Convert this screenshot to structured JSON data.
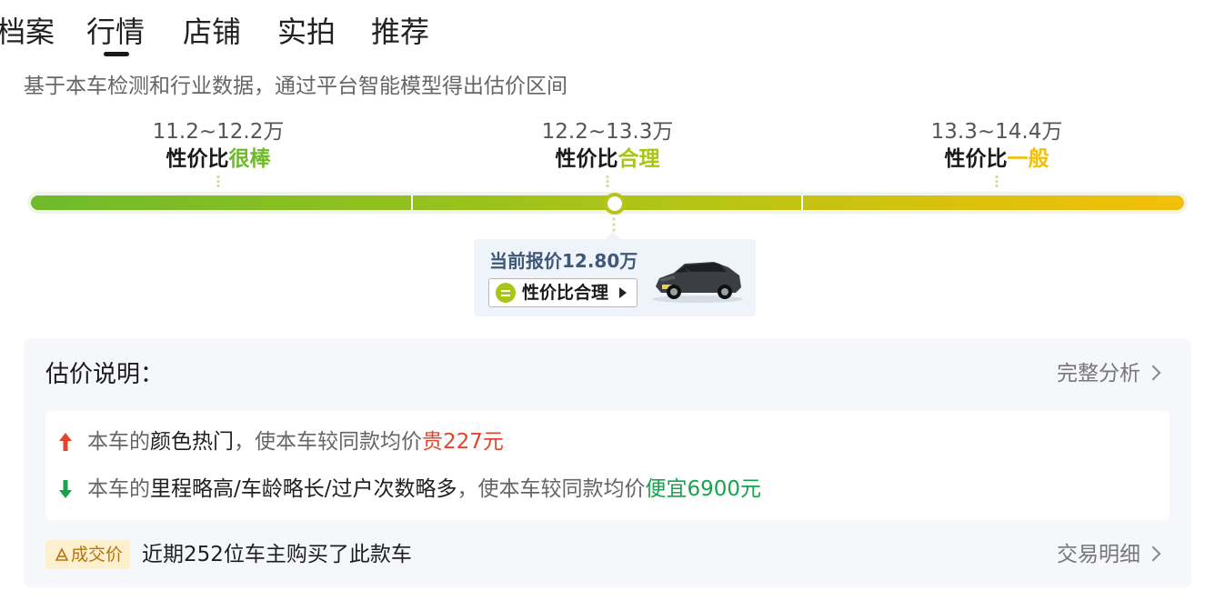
{
  "tabs": [
    {
      "label": "档案"
    },
    {
      "label": "行情",
      "active": true
    },
    {
      "label": "店铺"
    },
    {
      "label": "实拍"
    },
    {
      "label": "推荐"
    }
  ],
  "description": "基于本车检测和行业数据，通过平台智能模型得出估价区间",
  "price_tiers": [
    {
      "range": "11.2~12.2万",
      "label_prefix": "性价比",
      "label_rating": "很棒",
      "color": "#6fba2c"
    },
    {
      "range": "12.2~13.3万",
      "label_prefix": "性价比",
      "label_rating": "合理",
      "color": "#a9c515"
    },
    {
      "range": "13.3~14.4万",
      "label_prefix": "性价比",
      "label_rating": "一般",
      "color": "#f3c009"
    }
  ],
  "current": {
    "price_text": "当前报价12.80万",
    "value_button": "性价比合理",
    "car_image": "suv-thumbnail"
  },
  "explanation": {
    "title": "估价说明：",
    "full_analysis_link": "完整分析",
    "items": [
      {
        "direction": "up",
        "prefix": "本车的",
        "factor": "颜色热门",
        "middle": "，使本车较同款均价",
        "effect": "贵227元",
        "color": "#e2452a"
      },
      {
        "direction": "down",
        "prefix": "本车的",
        "factor": "里程略高/车龄略长/过户次数略多",
        "middle": "，使本车较同款均价",
        "effect": "便宜6900元",
        "color": "#17a24e"
      }
    ],
    "deal_badge": "成交价",
    "deal_text": "近期252位车主购买了此款车",
    "deal_link": "交易明细"
  }
}
